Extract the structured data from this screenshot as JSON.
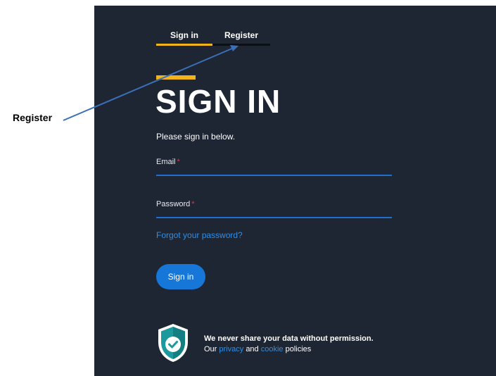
{
  "annotation": {
    "label": "Register"
  },
  "tabs": [
    {
      "label": "Sign in",
      "active": true
    },
    {
      "label": "Register",
      "active": false
    }
  ],
  "form": {
    "heading": "SIGN IN",
    "subtitle": "Please sign in below.",
    "email_label": "Email",
    "password_label": "Password",
    "required_marker": "*",
    "email_value": "",
    "password_value": "",
    "forgot_link": "Forgot your password?",
    "submit_label": "Sign in"
  },
  "privacy": {
    "title": "We never share your data without permission.",
    "prefix": "Our",
    "privacy_link": "privacy",
    "and": "and",
    "cookie_link": "cookie",
    "suffix": "policies",
    "icon": "shield-check-icon"
  },
  "colors": {
    "panel_bg": "#1e2533",
    "accent": "#f3b41b",
    "primary": "#1677d8",
    "link": "#2e8fe8",
    "required": "#e0364a",
    "shield": "#1a9a9c"
  }
}
